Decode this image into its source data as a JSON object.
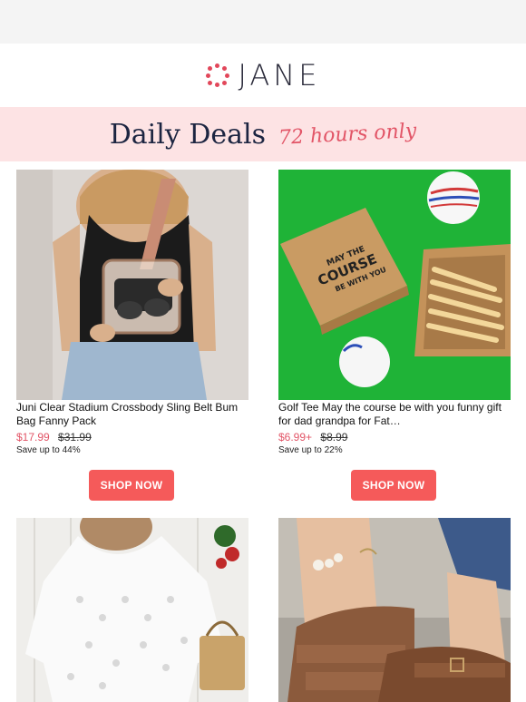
{
  "brand": {
    "name": "JANE"
  },
  "banner": {
    "title": "Daily Deals",
    "subtitle": "72 hours only"
  },
  "products": [
    {
      "title": "Juni Clear Stadium Crossbody Sling Belt Bum Bag Fanny Pack",
      "price": "$17.99",
      "old_price": "$31.99",
      "savings": "Save up to 44%",
      "button": "SHOP NOW"
    },
    {
      "title": "Golf Tee May the course be with you funny gift for dad grandpa for Fat…",
      "price": "$6.99+",
      "old_price": "$8.99",
      "savings": "Save up to 22%",
      "button": "SHOP NOW",
      "box_text": [
        "MAY THE",
        "COURSE",
        "BE WITH YOU"
      ]
    },
    {
      "title": "",
      "price": "",
      "old_price": "",
      "savings": "",
      "button": ""
    },
    {
      "title": "",
      "price": "",
      "old_price": "",
      "savings": "",
      "button": ""
    }
  ],
  "colors": {
    "accent": "#f55a5a",
    "price": "#e25567",
    "banner_bg": "#fde3e4",
    "navy": "#1c2541"
  }
}
